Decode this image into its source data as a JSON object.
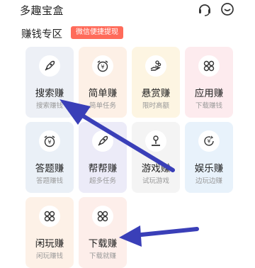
{
  "header": {
    "title": "多趣宝盒"
  },
  "section": {
    "title": "赚钱专区",
    "badge": "微信便捷提现"
  },
  "cards": [
    {
      "title": "搜索赚",
      "subtitle": "搜索赚钱",
      "icon": "rocket-icon",
      "bg": "#edf0f6"
    },
    {
      "title": "简单赚",
      "subtitle": "简单任务",
      "icon": "yen-alarm-icon",
      "bg": "#fdf0e6"
    },
    {
      "title": "悬赏赚",
      "subtitle": "限时高额",
      "icon": "hand-coins-icon",
      "bg": "#fdf5e2"
    },
    {
      "title": "应用赚",
      "subtitle": "下载赚钱",
      "icon": "clover-icon",
      "bg": "#fdebee"
    },
    {
      "title": "答题赚",
      "subtitle": "答题赚钱",
      "icon": "yen-alarm-icon",
      "bg": "#eaf0f7"
    },
    {
      "title": "帮帮赚",
      "subtitle": "超多任务",
      "icon": "rocket-icon",
      "bg": "#ecebf8"
    },
    {
      "title": "游戏赚",
      "subtitle": "试玩游戏",
      "icon": "joystick-icon",
      "bg": "#f4f4f4"
    },
    {
      "title": "娱乐赚",
      "subtitle": "边玩边赚",
      "icon": "yen-coin-icon",
      "bg": "#e8f2fb"
    },
    {
      "title": "闲玩赚",
      "subtitle": "闲玩赚钱",
      "icon": "clover-icon",
      "bg": "#fdf1e7"
    },
    {
      "title": "下载赚",
      "subtitle": "下载就赚",
      "icon": "clover-icon",
      "bg": "#fdeeea"
    }
  ]
}
